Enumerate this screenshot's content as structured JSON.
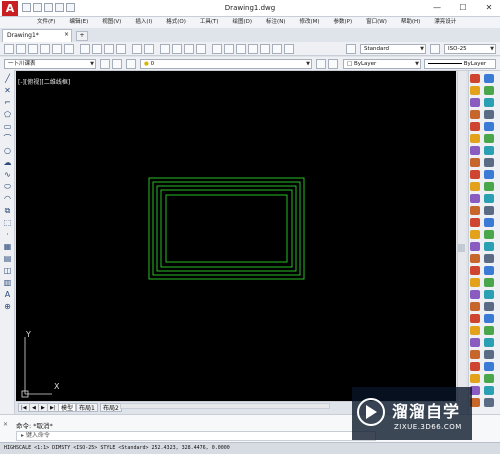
{
  "window": {
    "title": "Drawing1.dwg",
    "minimize": "—",
    "maximize": "☐",
    "close": "✕"
  },
  "app_logo": "A",
  "menu": [
    "文件(F)",
    "编辑(E)",
    "视图(V)",
    "插入(I)",
    "格式(O)",
    "工具(T)",
    "绘图(D)",
    "标注(N)",
    "修改(M)",
    "参数(P)",
    "窗口(W)",
    "帮助(H)",
    "漂亮设计"
  ],
  "doc_tab": {
    "label": "Drawing1*",
    "close": "×",
    "new": "+"
  },
  "toolbar1": {
    "text_style": "Standard",
    "dim_style": "ISO-25"
  },
  "toolbar2": {
    "workspace": "一卜川课表",
    "layer": "0",
    "color": "ByLayer",
    "linetype": "ByLayer"
  },
  "canvas": {
    "view_label": "[-][俯视][二维线框]",
    "ucs_y": "Y",
    "ucs_x": "X",
    "stroke": "#2bd02b",
    "background": "#000000"
  },
  "layout_tabs": [
    "模型",
    "布局1",
    "布局2"
  ],
  "command": {
    "history": "命令: *取消*",
    "prompt": "键入命令"
  },
  "status_bar": "HIGHSCALE <1:1> DIMSTY <ISO-25> STYLE <Standard>  252.4323, 328.4476, 0.0000",
  "watermark": {
    "name": "溜溜自学",
    "url": "ZIXUE.3D66.COM"
  }
}
